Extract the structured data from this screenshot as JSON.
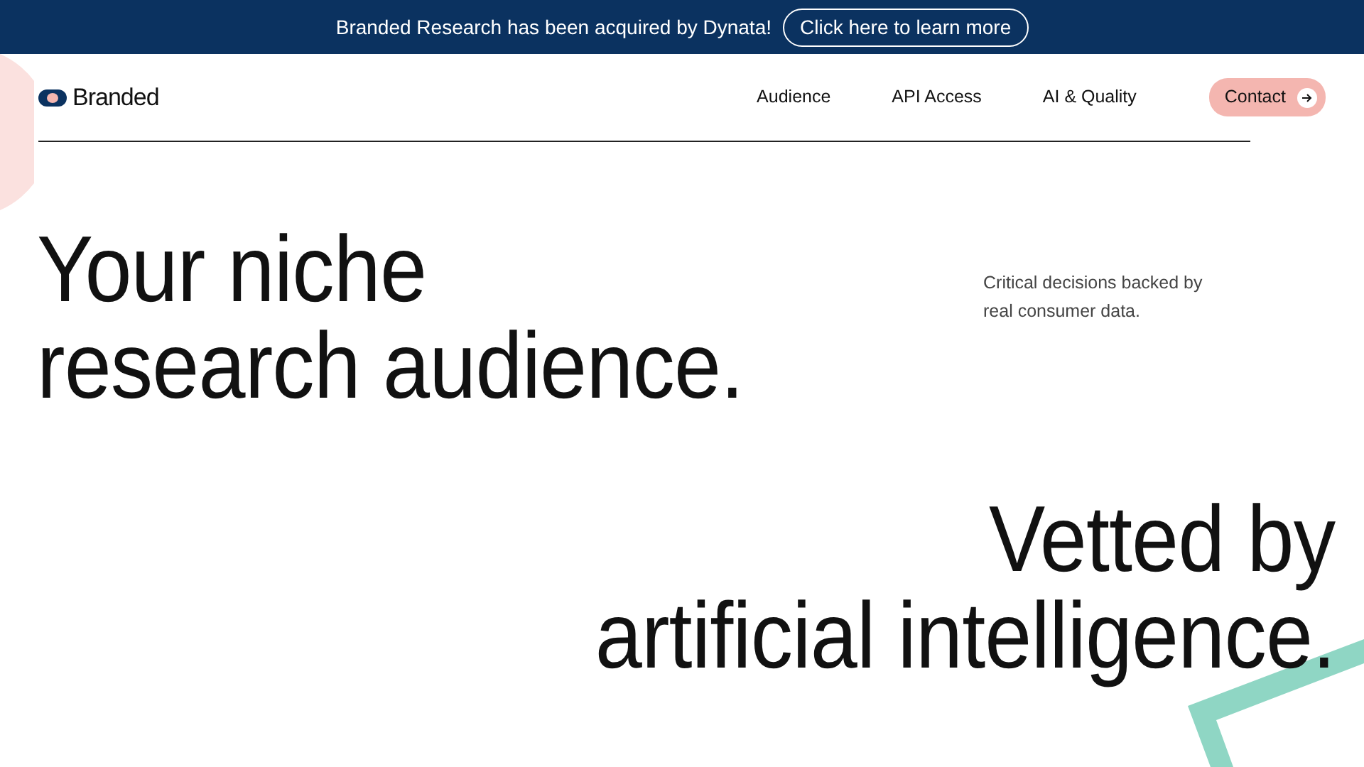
{
  "banner": {
    "text": "Branded Research has been acquired by Dynata!",
    "link": "Click here to learn more"
  },
  "nav": {
    "logo": "Branded",
    "links": [
      "Audience",
      "API Access",
      "AI & Quality"
    ],
    "contact": "Contact"
  },
  "hero": {
    "headline": [
      "Your niche",
      "research audience."
    ],
    "tagline": "Critical decisions backed by real consumer data."
  },
  "second": {
    "headline": [
      "Vetted by",
      "artificial intelligence."
    ]
  }
}
